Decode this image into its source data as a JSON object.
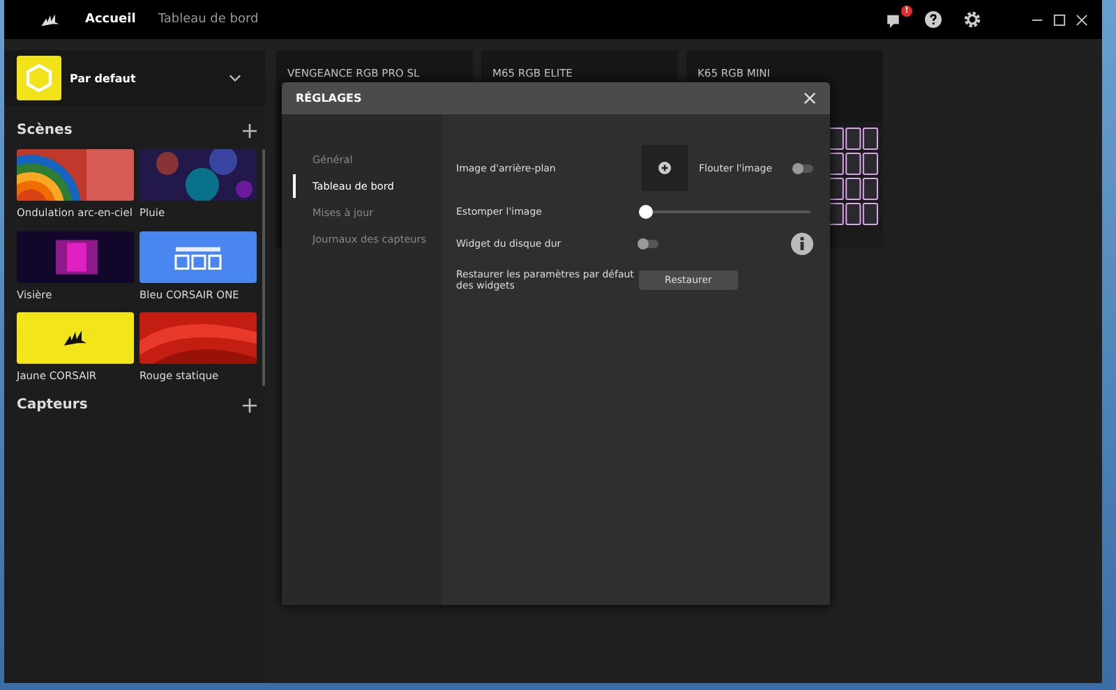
{
  "top_bar": {
    "tabs": [
      {
        "label": "Accueil",
        "selected": true
      },
      {
        "label": "Tableau de bord",
        "selected": false
      }
    ],
    "notification_badge": "!"
  },
  "profile": {
    "name": "Par defaut"
  },
  "scenes": {
    "title": "Scènes",
    "items": [
      {
        "label": "Ondulation arc-en-ciel",
        "kind": "rainbow"
      },
      {
        "label": "Pluie",
        "kind": "rain"
      },
      {
        "label": "Visière",
        "kind": "visor"
      },
      {
        "label": "Bleu CORSAIR ONE",
        "kind": "blue"
      },
      {
        "label": "Jaune CORSAIR",
        "kind": "yellow"
      },
      {
        "label": "Rouge statique",
        "kind": "red"
      }
    ]
  },
  "sensors": {
    "title": "Capteurs"
  },
  "devices": [
    {
      "name": "VENGEANCE RGB PRO SL",
      "image": false
    },
    {
      "name": "M65 RGB ELITE",
      "image": false
    },
    {
      "name": "K65 RGB MINI",
      "image": true
    }
  ],
  "dialog": {
    "title": "RÉGLAGES",
    "nav": [
      {
        "label": "Général",
        "selected": false
      },
      {
        "label": "Tableau de bord",
        "selected": true
      },
      {
        "label": "Mises à jour",
        "selected": false
      },
      {
        "label": "Journaux des capteurs",
        "selected": false
      }
    ],
    "background_label": "Image d'arrière-plan",
    "blur": {
      "label": "Flouter l'image",
      "on": false
    },
    "fade": {
      "label": "Estomper l'image",
      "level": 0
    },
    "disk_widget": {
      "label": "Widget du disque dur",
      "on": false
    },
    "restore": {
      "label": "Restaurer les paramètres par défaut des widgets",
      "button": "Restaurer"
    }
  }
}
